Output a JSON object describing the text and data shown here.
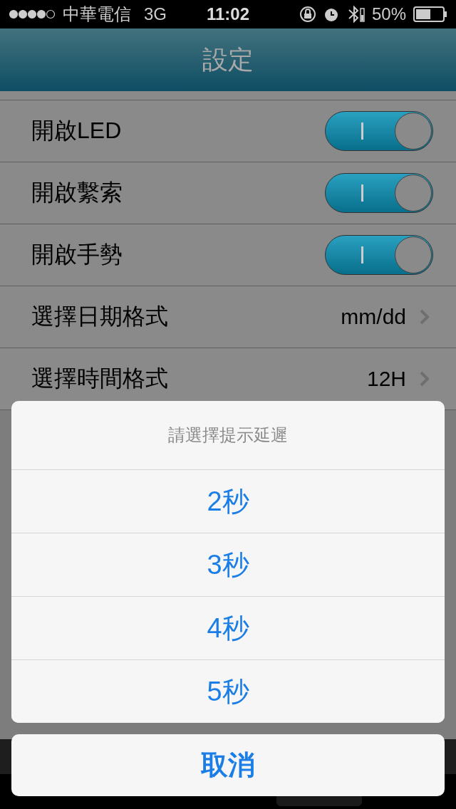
{
  "status_bar": {
    "carrier": "中華電信",
    "network": "3G",
    "time": "11:02",
    "battery": "50%"
  },
  "nav_bar": {
    "title": "設定"
  },
  "settings": [
    {
      "kind": "toggle",
      "label": "開啟LED",
      "on": true
    },
    {
      "kind": "toggle",
      "label": "開啟繫索",
      "on": true
    },
    {
      "kind": "toggle",
      "label": "開啟手勢",
      "on": true
    },
    {
      "kind": "value",
      "label": "選擇日期格式",
      "value": "mm/dd"
    },
    {
      "kind": "value",
      "label": "選擇時間格式",
      "value": "12H"
    }
  ],
  "action_sheet": {
    "title": "請選擇提示延遲",
    "options": [
      "2秒",
      "3秒",
      "4秒",
      "5秒"
    ],
    "cancel": "取消"
  },
  "tab_bar": {
    "tabs": [
      {
        "selected": false
      },
      {
        "selected": false
      },
      {
        "selected": false
      },
      {
        "selected": true
      },
      {
        "selected": false
      }
    ]
  }
}
